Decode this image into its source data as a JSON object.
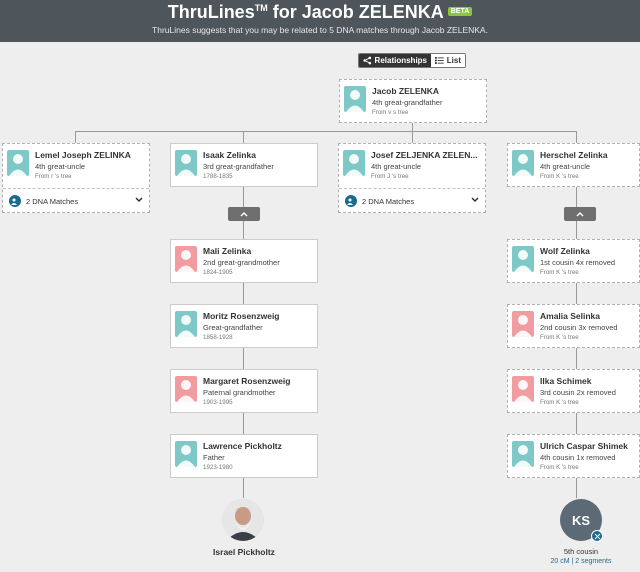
{
  "header": {
    "title": "ThruLines",
    "tm": "TM",
    "title_suffix": " for Jacob ZELENKA",
    "beta": "BETA",
    "subtitle": "ThruLines suggests that you may be related to 5 DNA matches through Jacob ZELENKA."
  },
  "view_toggle": {
    "relationships": "Relationships",
    "list": "List"
  },
  "ancestor": {
    "name": "Jacob ZELENKA",
    "relation": "4th great-grandfather",
    "source": "From v               s tree"
  },
  "children": [
    {
      "name": "Lemel Joseph ZELINKA",
      "relation": "4th great-uncle",
      "source": "From r                  's tree",
      "dna": "2 DNA Matches"
    },
    {
      "name": "Isaak Zelinka",
      "relation": "3rd great-grandfather",
      "source": "1788-1835"
    },
    {
      "name": "Josef ZELJENKA ZELEN...",
      "relation": "4th great-uncle",
      "source": "From J      's tree",
      "dna": "2 DNA Matches"
    },
    {
      "name": "Herschel Zelinka",
      "relation": "4th great-uncle",
      "source": "From K      's tree"
    }
  ],
  "left_line": [
    {
      "name": "Mali Zelinka",
      "relation": "2nd great-grandmother",
      "source": "1824-1905"
    },
    {
      "name": "Moritz Rosenzweig",
      "relation": "Great-grandfather",
      "source": "1858-1928"
    },
    {
      "name": "Margaret Rosenzweig",
      "relation": "Paternal grandmother",
      "source": "1903-1995"
    },
    {
      "name": "Lawrence Pickholtz",
      "relation": "Father",
      "source": "1923-1980"
    }
  ],
  "right_line": [
    {
      "name": "Wolf Zelinka",
      "relation": "1st cousin 4x removed",
      "source": "From K      's tree"
    },
    {
      "name": "Amalia Selinka",
      "relation": "2nd cousin 3x removed",
      "source": "From K      's tree"
    },
    {
      "name": "Ilka Schimek",
      "relation": "3rd cousin 2x removed",
      "source": "From K      's tree"
    },
    {
      "name": "Ulrich Caspar Shimek",
      "relation": "4th cousin 1x removed",
      "source": "From K      's tree"
    }
  ],
  "self": {
    "name": "Israel Pickholtz"
  },
  "match": {
    "initials": "KS",
    "relation": "5th cousin",
    "shared": "20 cM | 2 segments"
  },
  "colors": {
    "header": "#4e555b",
    "male": "#7ec8c8",
    "female": "#f19ca0",
    "accent": "#1e6a8c",
    "beta": "#8cc63f"
  }
}
